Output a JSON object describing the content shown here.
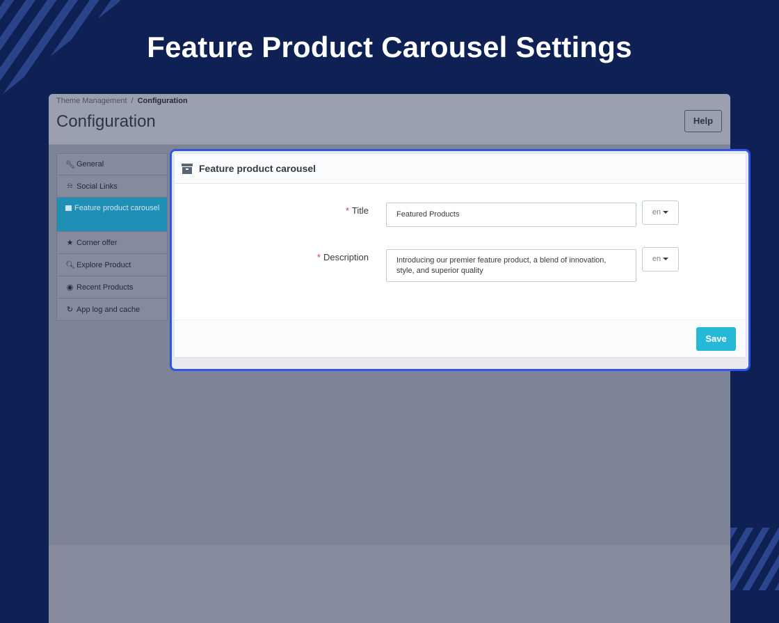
{
  "hero": {
    "title": "Feature Product Carousel Settings"
  },
  "admin": {
    "breadcrumb": {
      "parent": "Theme Management",
      "separator": "/",
      "current": "Configuration"
    },
    "page_title": "Configuration",
    "help_label": "Help",
    "sidebar": {
      "items": [
        {
          "label": "General",
          "icon": "wrench-icon"
        },
        {
          "label": "Social Links",
          "icon": "bell-icon"
        },
        {
          "label": "Feature product carousel",
          "icon": "archive-icon",
          "active": true
        },
        {
          "label": "Corner offer",
          "icon": "star-icon"
        },
        {
          "label": "Explore Product",
          "icon": "search-icon"
        },
        {
          "label": "Recent Products",
          "icon": "eye-icon"
        },
        {
          "label": "App log and cache",
          "icon": "refresh-icon"
        }
      ]
    }
  },
  "panel": {
    "title": "Feature product carousel",
    "fields": {
      "title": {
        "required_mark": "*",
        "label": "Title",
        "value": "Featured Products",
        "lang": "en"
      },
      "description": {
        "required_mark": "*",
        "label": "Description",
        "value": "Introducing our premier feature product, a blend of innovation, style, and superior quality",
        "lang": "en"
      }
    },
    "save_label": "Save"
  },
  "colors": {
    "background": "#0f2054",
    "highlight": "#2f55e6",
    "primary": "#25b9d7",
    "active_tab": "#1f8fb5",
    "required": "#e8323c"
  }
}
